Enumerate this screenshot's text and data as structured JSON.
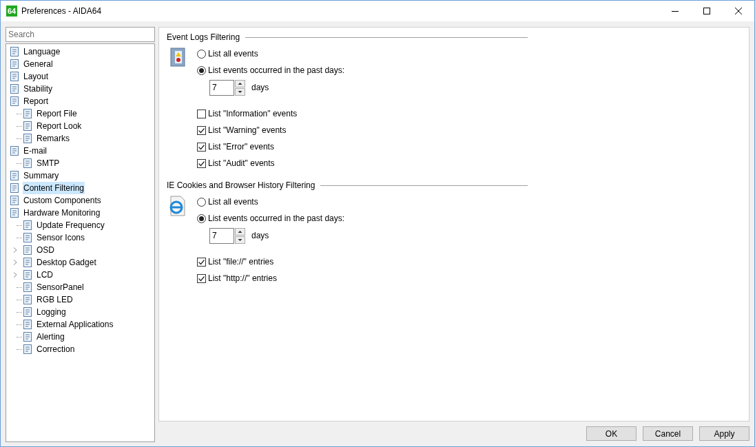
{
  "window": {
    "title": "Preferences - AIDA64",
    "app_badge": "64"
  },
  "search": {
    "placeholder": "Search"
  },
  "tree": [
    {
      "label": "Language",
      "selected": false
    },
    {
      "label": "General",
      "selected": false
    },
    {
      "label": "Layout",
      "selected": false
    },
    {
      "label": "Stability",
      "selected": false
    },
    {
      "label": "Report",
      "selected": false,
      "children": [
        {
          "label": "Report File",
          "selected": false
        },
        {
          "label": "Report Look",
          "selected": false
        },
        {
          "label": "Remarks",
          "selected": false
        }
      ]
    },
    {
      "label": "E-mail",
      "selected": false,
      "children": [
        {
          "label": "SMTP",
          "selected": false
        }
      ]
    },
    {
      "label": "Summary",
      "selected": false
    },
    {
      "label": "Content Filtering",
      "selected": true
    },
    {
      "label": "Custom Components",
      "selected": false
    },
    {
      "label": "Hardware Monitoring",
      "selected": false,
      "children": [
        {
          "label": "Update Frequency",
          "selected": false
        },
        {
          "label": "Sensor Icons",
          "selected": false
        },
        {
          "label": "OSD",
          "selected": false,
          "expandable": true
        },
        {
          "label": "Desktop Gadget",
          "selected": false,
          "expandable": true
        },
        {
          "label": "LCD",
          "selected": false,
          "expandable": true
        },
        {
          "label": "SensorPanel",
          "selected": false
        },
        {
          "label": "RGB LED",
          "selected": false
        },
        {
          "label": "Logging",
          "selected": false
        },
        {
          "label": "External Applications",
          "selected": false
        },
        {
          "label": "Alerting",
          "selected": false
        },
        {
          "label": "Correction",
          "selected": false
        }
      ]
    }
  ],
  "sections": [
    {
      "title": "Event Logs Filtering",
      "radios": [
        {
          "label": "List all events",
          "selected": false
        },
        {
          "label": "List events occurred in the past days:",
          "selected": true
        }
      ],
      "days_value": "7",
      "days_unit": "days",
      "checkboxes": [
        {
          "label": "List \"Information\" events",
          "checked": false
        },
        {
          "label": "List \"Warning\" events",
          "checked": true
        },
        {
          "label": "List \"Error\" events",
          "checked": true
        },
        {
          "label": "List \"Audit\" events",
          "checked": true
        }
      ]
    },
    {
      "title": "IE Cookies and Browser History Filtering",
      "radios": [
        {
          "label": "List all events",
          "selected": false
        },
        {
          "label": "List events occurred in the past days:",
          "selected": true
        }
      ],
      "days_value": "7",
      "days_unit": "days",
      "checkboxes": [
        {
          "label": "List \"file://\" entries",
          "checked": true
        },
        {
          "label": "List \"http://\" entries",
          "checked": true
        }
      ]
    }
  ],
  "buttons": [
    "OK",
    "Cancel",
    "Apply"
  ]
}
